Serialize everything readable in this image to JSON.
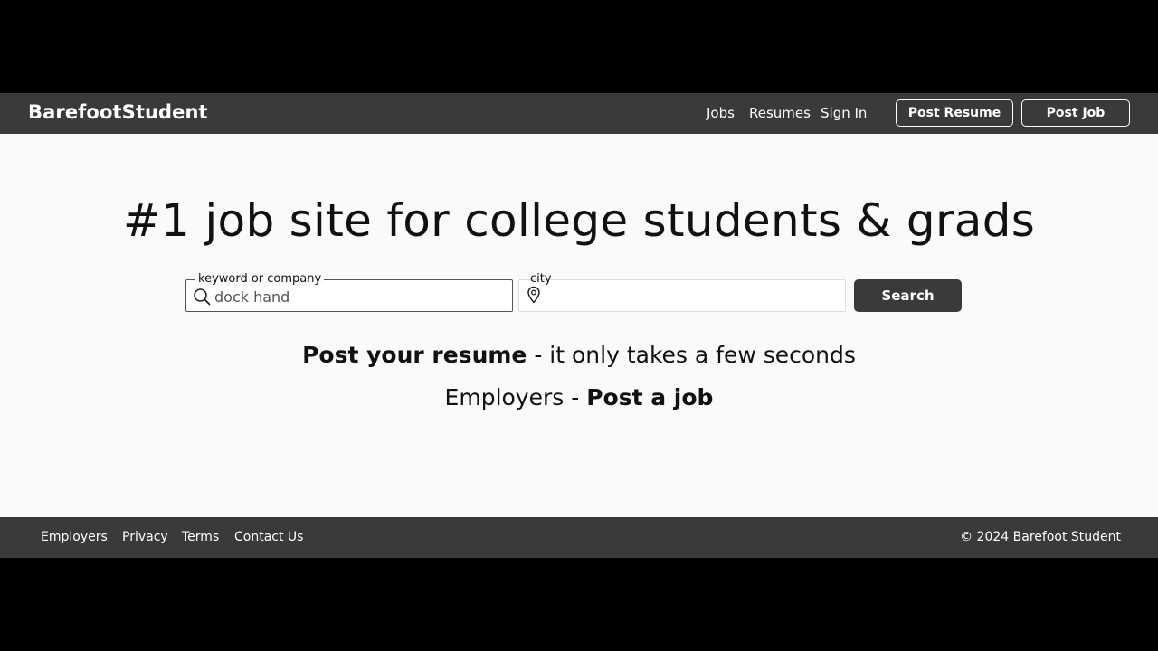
{
  "header": {
    "brand": "BarefootStudent",
    "nav": {
      "jobs": "Jobs",
      "resumes": "Resumes",
      "sign_in": "Sign In"
    },
    "buttons": {
      "post_resume": "Post Resume",
      "post_job": "Post Job"
    }
  },
  "main": {
    "title": "#1 job site for college students & grads",
    "search": {
      "keyword_legend": "keyword or company",
      "keyword_value": "dock hand",
      "keyword_icon": "search-icon",
      "city_legend": "city",
      "city_value": "",
      "city_icon": "location-pin-icon",
      "button_label": "Search"
    },
    "cta": {
      "resume_link": "Post your resume",
      "resume_text": " - it only takes a few seconds",
      "employers_text": "Employers - ",
      "job_link": "Post a job"
    }
  },
  "footer": {
    "links": {
      "employers": "Employers",
      "privacy": "Privacy",
      "terms": "Terms",
      "contact": "Contact Us"
    },
    "copyright": "© 2024 Barefoot Student"
  },
  "colors": {
    "header_bg": "#3a3a3a",
    "page_bg": "#fafafa",
    "text": "#111111",
    "outer_bg": "#000000"
  }
}
